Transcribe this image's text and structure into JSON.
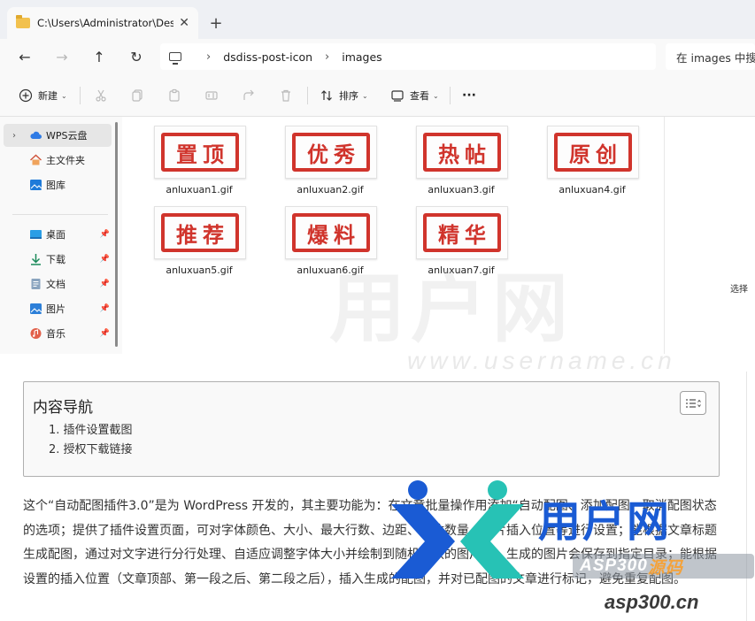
{
  "window": {
    "tab_title": "C:\\Users\\Administrator\\Deskto",
    "close_glyph": "✕",
    "new_tab_glyph": "+"
  },
  "nav": {
    "back_glyph": "←",
    "forward_glyph": "→",
    "up_glyph": "↑",
    "refresh_glyph": "↻"
  },
  "address": {
    "sep": "›",
    "crumbs": [
      "dsdiss-post-icon",
      "images"
    ]
  },
  "search": {
    "placeholder": "在 images 中搜"
  },
  "toolbar": {
    "new_label": "新建",
    "sort_label": "排序",
    "view_label": "查看",
    "more_glyph": "···",
    "caret": "⌄",
    "icons": [
      "plus-icon",
      "cut-icon",
      "copy-icon",
      "paste-icon",
      "rename-icon",
      "share-icon",
      "delete-icon",
      "sort-icon",
      "view-icon",
      "more-icon"
    ]
  },
  "sidebar": {
    "items": [
      {
        "label": "WPS云盘",
        "icon": "cloud-icon",
        "expandable": true,
        "pinned": false
      },
      {
        "label": "主文件夹",
        "icon": "home-icon",
        "expandable": false,
        "pinned": false
      },
      {
        "label": "图库",
        "icon": "gallery-icon",
        "expandable": false,
        "pinned": false
      },
      {
        "label": "桌面",
        "icon": "desktop-icon",
        "expandable": false,
        "pinned": true
      },
      {
        "label": "下载",
        "icon": "download-icon",
        "expandable": false,
        "pinned": true
      },
      {
        "label": "文档",
        "icon": "document-icon",
        "expandable": false,
        "pinned": true
      },
      {
        "label": "图片",
        "icon": "pictures-icon",
        "expandable": false,
        "pinned": true
      },
      {
        "label": "音乐",
        "icon": "music-icon",
        "expandable": false,
        "pinned": true
      }
    ],
    "chevron": "›",
    "pin_glyph": "📌"
  },
  "files": [
    {
      "name": "anluxuan1.gif",
      "stamp": "置顶"
    },
    {
      "name": "anluxuan2.gif",
      "stamp": "优秀"
    },
    {
      "name": "anluxuan3.gif",
      "stamp": "热帖"
    },
    {
      "name": "anluxuan4.gif",
      "stamp": "原创"
    },
    {
      "name": "anluxuan5.gif",
      "stamp": "推荐"
    },
    {
      "name": "anluxuan6.gif",
      "stamp": "爆料"
    },
    {
      "name": "anluxuan7.gif",
      "stamp": "精华"
    }
  ],
  "details_hint": "选择",
  "watermark": {
    "big": "用户网",
    "url": "www.username.cn"
  },
  "toc": {
    "title": "内容导航",
    "toggle_glyph": "☰⇕",
    "items": [
      "1. 插件设置截图",
      "2. 授权下载链接"
    ]
  },
  "article": {
    "text": "这个“自动配图插件3.0”是为 WordPress 开发的，其主要功能为：在文章批量操作用添加“自动配图、添加配图、取消配图状态的选项；提供了插件设置页面，可对字体颜色、大小、最大行数、边距、字体数量、图片插入位置等进行设置；能根据文章标题生成配图，通过对文字进行分行处理、自适应调整字体大小并绘制到随机选取的图片上，生成的图片会保存到指定目录；能根据设置的插入位置（文章顶部、第一段之后、第二段之后），插入生成的配图，并对已配图的文章进行标记，避免重复配图。"
  },
  "logo": {
    "title": "用户网",
    "pill_text": "ASP300",
    "pill_accent": "源码",
    "site": "asp300.cn",
    "colors": {
      "blue": "#1a5bd4",
      "teal": "#27c2b5",
      "orange": "#f4a23a"
    }
  }
}
